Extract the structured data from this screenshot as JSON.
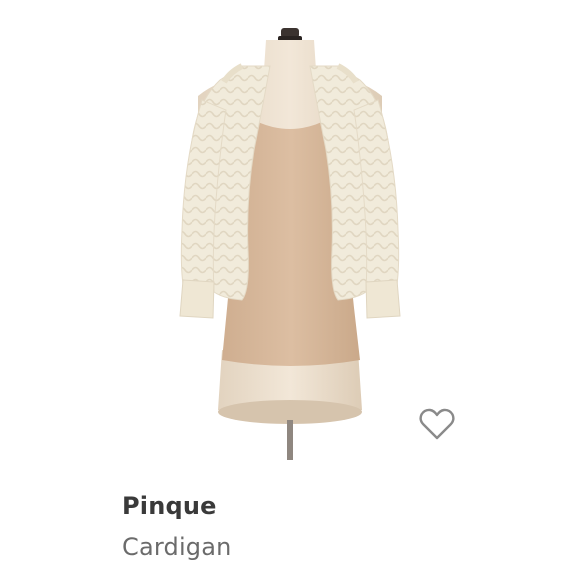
{
  "product": {
    "brand": "Pinque",
    "category": "Cardigan",
    "image_alt": "cream-knit-cardigan-over-tan-tank-on-mannequin"
  },
  "actions": {
    "favorite_icon": "heart-outline-icon"
  },
  "colors": {
    "background": "#ffffff",
    "brand_text": "#3a3a3a",
    "category_text": "#6b6b6b",
    "heart_stroke": "#8a8a8a",
    "tank": "#d8b89a",
    "cardigan": "#f1ebdb",
    "mannequin": "#e9dccb"
  }
}
